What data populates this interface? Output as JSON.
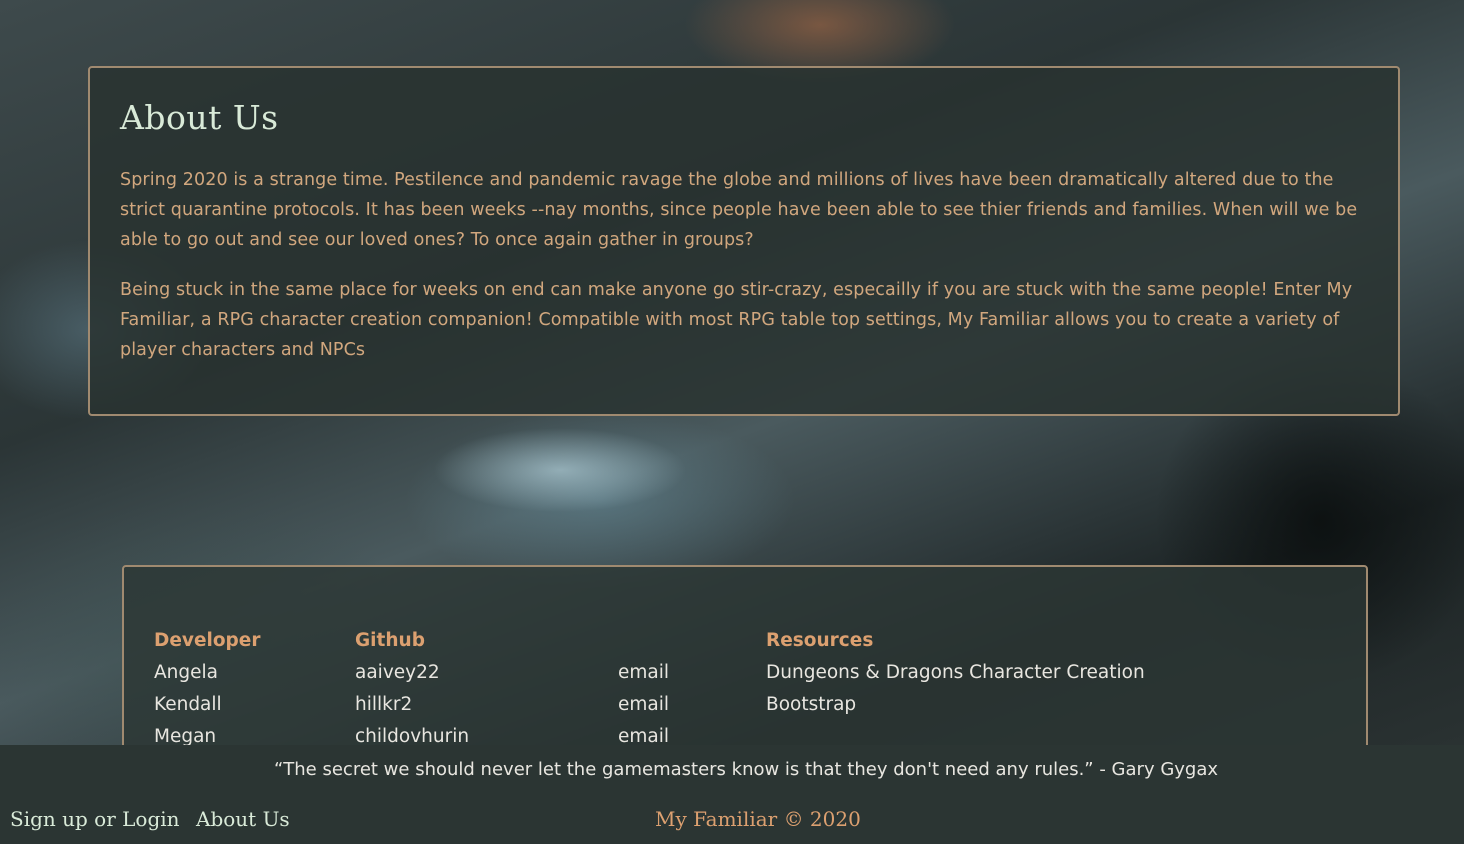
{
  "about": {
    "title": "About Us",
    "paragraphs": [
      "Spring 2020 is a strange time. Pestilence and pandemic ravage the globe and millions of lives have been dramatically altered due to the strict quarantine protocols. It has been weeks --nay months, since people have been able to see thier friends and families. When will we be able to go out and see our loved ones? To once again gather in groups?",
      "Being stuck in the same place for weeks on end can make anyone go stir-crazy, especailly if you are stuck with the same people! Enter My Familiar, a RPG character creation companion! Compatible with most RPG table top settings, My Familiar allows you to create a variety of player characters and NPCs"
    ]
  },
  "team": {
    "headers": {
      "developer": "Developer",
      "github": "Github",
      "resources": "Resources"
    },
    "developers": [
      "Angela",
      "Kendall",
      "Megan"
    ],
    "githubs": [
      "aaivey22",
      "hillkr2",
      "childovhurin"
    ],
    "emails": [
      "email",
      "email",
      "email"
    ],
    "resources": [
      "Dungeons & Dragons Character Creation",
      "Bootstrap"
    ]
  },
  "footer": {
    "quote": "“The secret we should never let the gamemasters know is that they don't need any rules.” - Gary Gygax",
    "nav": {
      "signup": "Sign up or Login",
      "about": "About Us"
    },
    "copyright": "My Familiar © 2020"
  },
  "colors": {
    "accent": "#dca070",
    "border": "#a08a70",
    "footer_bg": "#2b3533"
  }
}
